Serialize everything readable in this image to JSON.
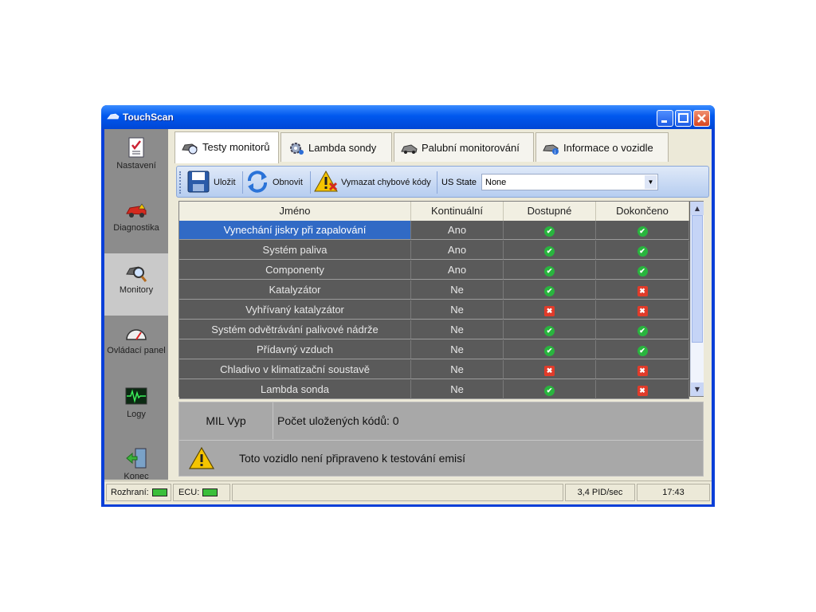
{
  "window": {
    "title": "TouchScan"
  },
  "sidebar": {
    "items": [
      {
        "label": "Nastavení",
        "icon": "checklist-icon"
      },
      {
        "label": "Diagnostika",
        "icon": "car-icon"
      },
      {
        "label": "Monitory",
        "icon": "magnifier-icon",
        "active": true
      },
      {
        "label": "Ovládací panel",
        "icon": "gauge-icon"
      },
      {
        "label": "Logy",
        "icon": "waveform-icon"
      },
      {
        "label": "Konec",
        "icon": "exit-door-icon"
      }
    ]
  },
  "tabs": [
    {
      "label": "Testy monitorů",
      "active": true
    },
    {
      "label": "Lambda sondy"
    },
    {
      "label": "Palubní monitorování"
    },
    {
      "label": "Informace o vozidle"
    }
  ],
  "toolbar": {
    "save_label": "Uložit",
    "refresh_label": "Obnovit",
    "clear_codes_label": "Vymazat chybové kódy",
    "us_state_label": "US State",
    "us_state_value": "None"
  },
  "table": {
    "columns": [
      "Jméno",
      "Kontinuální",
      "Dostupné",
      "Dokončeno"
    ],
    "rows": [
      {
        "name": "Vynechání jiskry při zapalování",
        "continuous": "Ano",
        "available": "ok",
        "completed": "ok",
        "selected": true
      },
      {
        "name": "Systém paliva",
        "continuous": "Ano",
        "available": "ok",
        "completed": "ok"
      },
      {
        "name": "Componenty",
        "continuous": "Ano",
        "available": "ok",
        "completed": "ok"
      },
      {
        "name": "Katalyzátor",
        "continuous": "Ne",
        "available": "ok",
        "completed": "fail"
      },
      {
        "name": "Vyhřívaný katalyzátor",
        "continuous": "Ne",
        "available": "fail",
        "completed": "fail"
      },
      {
        "name": "Systém odvětrávání palivové nádrže",
        "continuous": "Ne",
        "available": "ok",
        "completed": "ok"
      },
      {
        "name": "Přídavný vzduch",
        "continuous": "Ne",
        "available": "ok",
        "completed": "ok"
      },
      {
        "name": "Chladivo v klimatizační soustavě",
        "continuous": "Ne",
        "available": "fail",
        "completed": "fail"
      },
      {
        "name": "Lambda sonda",
        "continuous": "Ne",
        "available": "ok",
        "completed": "fail"
      }
    ]
  },
  "info": {
    "mil": "MIL Vyp",
    "stored_codes": "Počet uložených kódů: 0",
    "warning": "Toto vozidlo není připraveno k testování emisí"
  },
  "statusbar": {
    "interface_label": "Rozhraní:",
    "ecu_label": "ECU:",
    "rate": "3,4 PID/sec",
    "time": "17:43"
  },
  "colors": {
    "titlebar": "#0058ee",
    "selection": "#316ac5",
    "grid_bg": "#5a5a5a",
    "ok": "#29b53e",
    "fail": "#e03b2a"
  }
}
